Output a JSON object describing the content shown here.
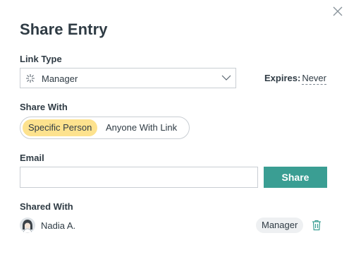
{
  "dialog": {
    "title": "Share Entry",
    "close_icon": "close-icon"
  },
  "link_type": {
    "label": "Link Type",
    "selected": "Manager",
    "icon": "sparkle-icon"
  },
  "expires": {
    "label": "Expires:",
    "value": "Never"
  },
  "share_with": {
    "label": "Share With",
    "options": [
      "Specific Person",
      "Anyone With Link"
    ],
    "active_index": 0
  },
  "email": {
    "label": "Email",
    "value": "",
    "placeholder": ""
  },
  "share_button": {
    "label": "Share"
  },
  "shared_with": {
    "label": "Shared With",
    "users": [
      {
        "name": "Nadia A.",
        "role": "Manager",
        "avatar_icon": "avatar-icon",
        "delete_icon": "trash-icon"
      }
    ]
  },
  "colors": {
    "accent": "#3a9e93",
    "toggle_active": "#fde28e",
    "text": "#2f3b44",
    "border": "#c9ced3"
  }
}
